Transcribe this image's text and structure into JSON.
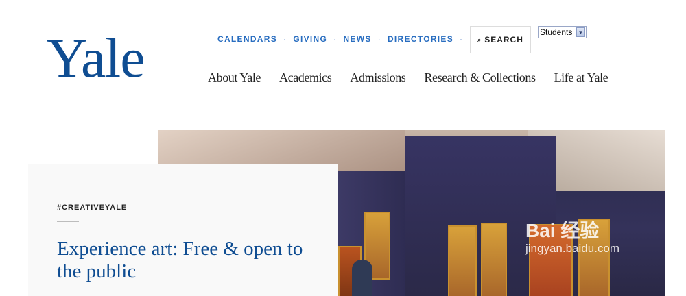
{
  "logo": {
    "text": "Yale",
    "color": "#0f4d92"
  },
  "utility_nav": {
    "items": [
      "CALENDARS",
      "GIVING",
      "NEWS",
      "DIRECTORIES"
    ],
    "separator": "·",
    "color": "#286dc0"
  },
  "search": {
    "label": "SEARCH",
    "icon": "search-icon"
  },
  "audience_select": {
    "value": "Students"
  },
  "main_nav": {
    "items": [
      "About Yale",
      "Academics",
      "Admissions",
      "Research & Collections",
      "Life at Yale"
    ]
  },
  "feature": {
    "tag": "#CREATIVEYALE",
    "headline": "Experience art: Free & open to the public"
  },
  "watermark": {
    "logo": "Bai 经验",
    "url": "jingyan.baidu.com"
  }
}
